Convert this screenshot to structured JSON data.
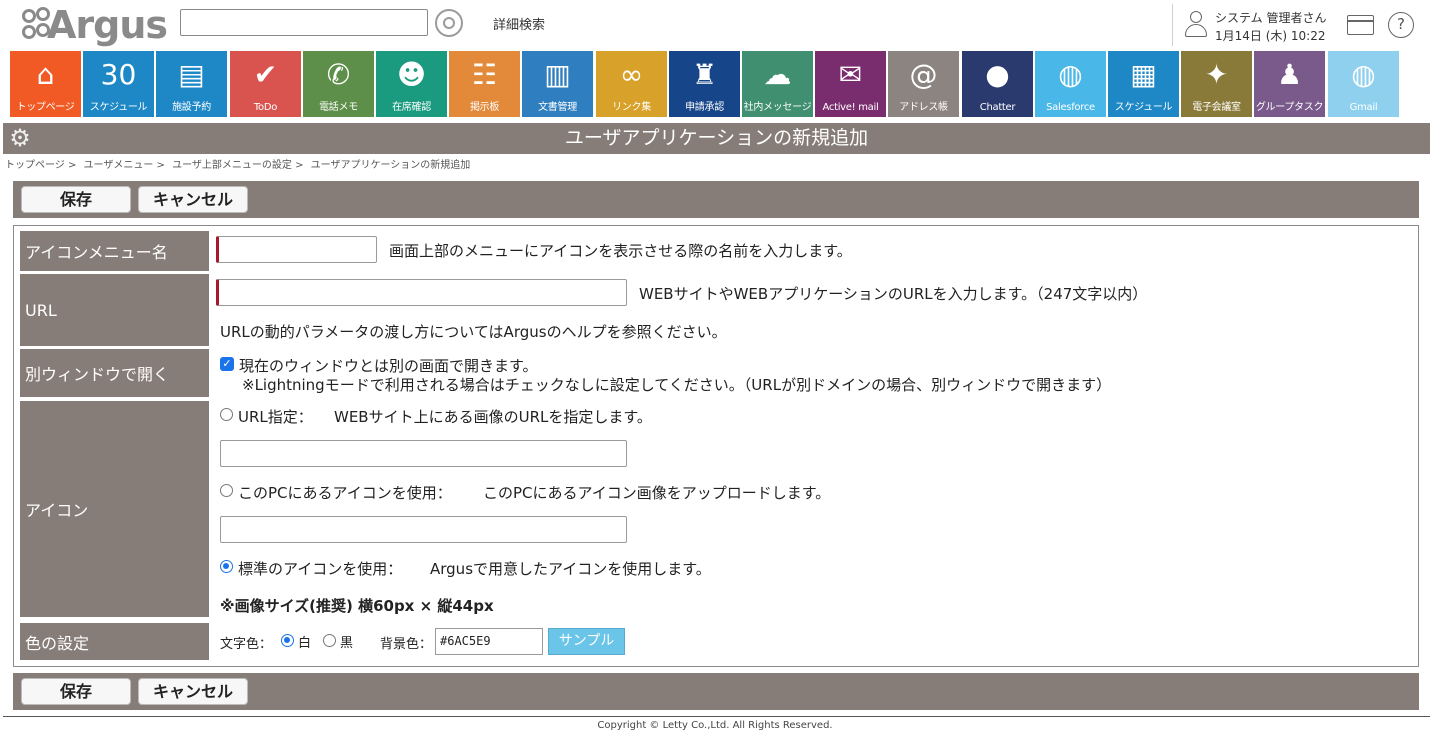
{
  "header": {
    "logo_text": "Argus",
    "search": {
      "value": "",
      "placeholder": ""
    },
    "advanced_search_label": "詳細検索",
    "user_name": "システム 管理者さん",
    "date_time": "1月14日 (木) 10:22",
    "help_glyph": "?"
  },
  "apps": [
    {
      "label": "トップページ",
      "color": "#f15a24",
      "icon": "⌂",
      "icon_name": "home-icon"
    },
    {
      "label": "スケジュール",
      "color": "#1e88c7",
      "icon": "30",
      "icon_name": "calendar-icon"
    },
    {
      "label": "施設予約",
      "color": "#1e88c7",
      "icon": "▤",
      "icon_name": "facility-icon"
    },
    {
      "label": "ToDo",
      "color": "#d9534f",
      "icon": "✔",
      "icon_name": "todo-icon"
    },
    {
      "label": "電話メモ",
      "color": "#5e8f4a",
      "icon": "✆",
      "icon_name": "phone-memo-icon"
    },
    {
      "label": "在席確認",
      "color": "#1a9b7f",
      "icon": "☻",
      "icon_name": "presence-icon"
    },
    {
      "label": "掲示板",
      "color": "#e28a3a",
      "icon": "☷",
      "icon_name": "bulletin-icon"
    },
    {
      "label": "文書管理",
      "color": "#2f7fc0",
      "icon": "▥",
      "icon_name": "documents-icon"
    },
    {
      "label": "リンク集",
      "color": "#d8a129",
      "icon": "∞",
      "icon_name": "link-icon"
    },
    {
      "label": "申請承認",
      "color": "#16458a",
      "icon": "♜",
      "icon_name": "approval-stamp-icon"
    },
    {
      "label": "社内メッセージ",
      "color": "#3f8f70",
      "icon": "☁",
      "icon_name": "message-icon"
    },
    {
      "label": "Active! mail",
      "color": "#7a2d6e",
      "icon": "✉",
      "icon_name": "mail-icon"
    },
    {
      "label": "アドレス帳",
      "color": "#8c8481",
      "icon": "@",
      "icon_name": "address-book-icon"
    },
    {
      "label": "Chatter",
      "color": "#2a3a6e",
      "icon": "●",
      "icon_name": "chatter-icon"
    },
    {
      "label": "Salesforce",
      "color": "#49b7e8",
      "icon": "◍",
      "icon_name": "globe-icon"
    },
    {
      "label": "スケジュール",
      "color": "#1e88c7",
      "icon": "▦",
      "icon_name": "schedule-window-icon"
    },
    {
      "label": "電子会議室",
      "color": "#8a7a3a",
      "icon": "✦",
      "icon_name": "meeting-room-icon"
    },
    {
      "label": "グループタスク",
      "color": "#7a5a8a",
      "icon": "♟",
      "icon_name": "group-task-icon"
    },
    {
      "label": "Gmail",
      "color": "#8fd0ee",
      "icon": "◍",
      "icon_name": "globe-icon"
    }
  ],
  "title": "ユーザアプリケーションの新規追加",
  "breadcrumb": [
    "トップページ >",
    "ユーザメニュー >",
    "ユーザ上部メニューの設定 >",
    "ユーザアプリケーションの新規追加"
  ],
  "buttons": {
    "save": "保存",
    "cancel": "キャンセル"
  },
  "form": {
    "icon_menu_name": {
      "label": "アイコンメニュー名",
      "value": "",
      "hint": "画面上部のメニューにアイコンを表示させる際の名前を入力します。"
    },
    "url": {
      "label": "URL",
      "value": "",
      "hint": "WEBサイトやWEBアプリケーションのURLを入力します。（247文字以内）",
      "note": "URLの動的パラメータの渡し方についてはArgusのヘルプを参照ください。"
    },
    "new_window": {
      "label": "別ウィンドウで開く",
      "checked": true,
      "text": "現在のウィンドウとは別の画面で開きます。",
      "note": "※Lightningモードで利用される場合はチェックなしに設定してください。（URLが別ドメインの場合、別ウィンドウで開きます）"
    },
    "icon": {
      "label": "アイコン",
      "options": [
        {
          "label": "URL指定：",
          "desc": "WEBサイト上にある画像のURLを指定します。",
          "selected": false
        },
        {
          "label": "このPCにあるアイコンを使用：",
          "desc": "このPCにあるアイコン画像をアップロードします。",
          "selected": false
        },
        {
          "label": "標準のアイコンを使用：",
          "desc": "Argusで用意したアイコンを使用します。",
          "selected": true
        }
      ],
      "url_value": "",
      "file_value": "",
      "size_note": "※画像サイズ(推奨) 横60px × 縦44px"
    },
    "color": {
      "label": "色の設定",
      "text_color_label": "文字色：",
      "white_label": "白",
      "black_label": "黒",
      "selected": "白",
      "bg_label": "背景色：",
      "bg_value": "#6AC5E9",
      "sample_label": "サンプル"
    }
  },
  "footer": {
    "copyright": "Copyright © Letty Co.,Ltd. All Rights Reserved."
  },
  "colors": {
    "bar": "#877d78",
    "required": "#a8182b",
    "sample": "#6ac5e9"
  }
}
